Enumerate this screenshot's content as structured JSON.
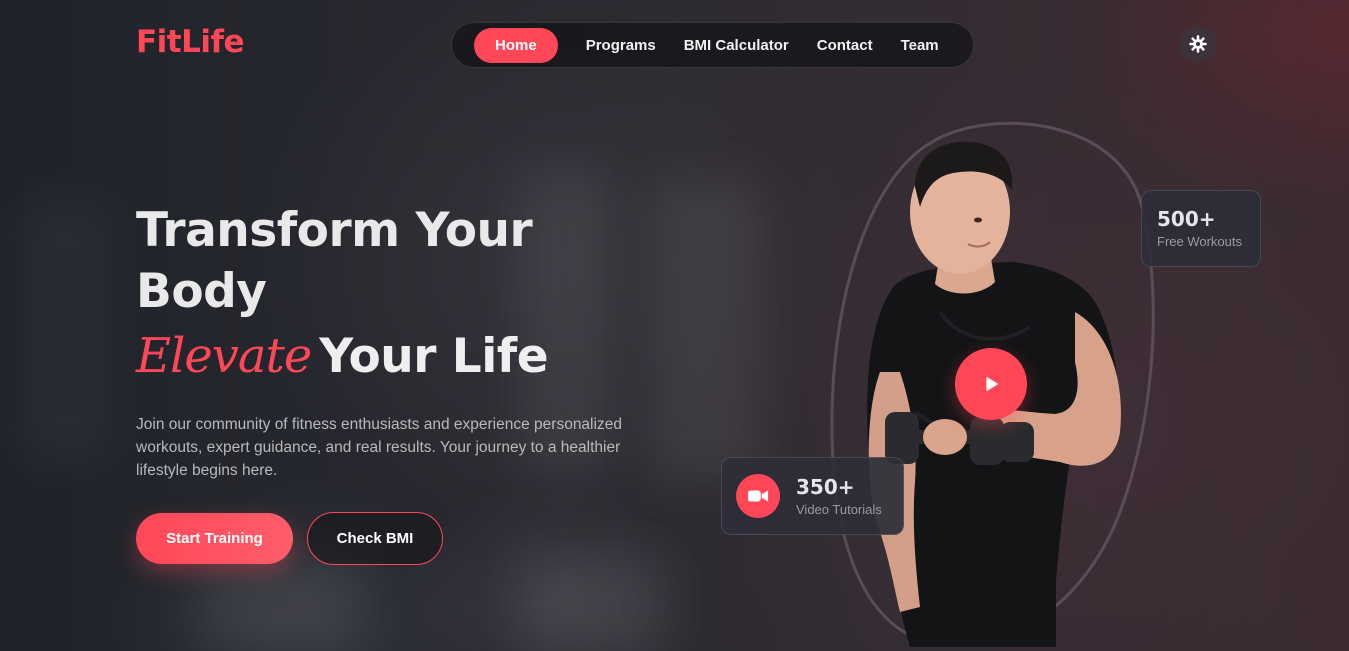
{
  "brand": {
    "logo": "FitLife"
  },
  "nav": {
    "items": [
      {
        "label": "Home",
        "active": true
      },
      {
        "label": "Programs",
        "active": false
      },
      {
        "label": "BMI Calculator",
        "active": false
      },
      {
        "label": "Contact",
        "active": false
      },
      {
        "label": "Team",
        "active": false
      }
    ],
    "theme_toggle_icon": "gear-icon"
  },
  "hero": {
    "title_line1": "Transform Your Body",
    "script_word": "Elevate",
    "title_line2": "Your Life",
    "description": "Join our community of fitness enthusiasts and experience personalized workouts, expert guidance, and real results. Your journey to a healthier lifestyle begins here.",
    "primary_button": "Start Training",
    "secondary_button": "Check BMI"
  },
  "stats": {
    "workouts": {
      "value": "500+",
      "label": "Free Workouts"
    },
    "tutorials": {
      "value": "350+",
      "label": "Video Tutorials",
      "icon": "video-camera-icon"
    }
  },
  "media": {
    "play_icon": "play-icon"
  },
  "colors": {
    "accent": "#ff4757",
    "background": "#22252b",
    "card": "#2c2e38"
  }
}
